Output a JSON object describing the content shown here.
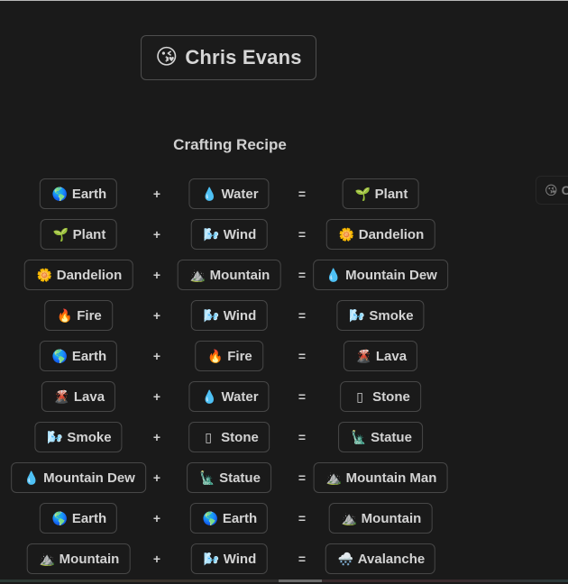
{
  "title_badge": {
    "emoji": "😘",
    "name": "Chris Evans"
  },
  "heading": "Crafting Recipe",
  "operators": {
    "plus": "+",
    "equals": "="
  },
  "recipes": [
    {
      "a": {
        "icon": "🌎",
        "label": "Earth"
      },
      "b": {
        "icon": "💧",
        "label": "Water"
      },
      "result": {
        "icon": "🌱",
        "label": "Plant"
      }
    },
    {
      "a": {
        "icon": "🌱",
        "label": "Plant"
      },
      "b": {
        "icon": "🌬️",
        "label": "Wind"
      },
      "result": {
        "icon": "🌼",
        "label": "Dandelion"
      }
    },
    {
      "a": {
        "icon": "🌼",
        "label": "Dandelion"
      },
      "b": {
        "icon": "⛰️",
        "label": "Mountain"
      },
      "result": {
        "icon": "💧",
        "label": "Mountain Dew"
      }
    },
    {
      "a": {
        "icon": "🔥",
        "label": "Fire"
      },
      "b": {
        "icon": "🌬️",
        "label": "Wind"
      },
      "result": {
        "icon": "🌬️",
        "label": "Smoke"
      }
    },
    {
      "a": {
        "icon": "🌎",
        "label": "Earth"
      },
      "b": {
        "icon": "🔥",
        "label": "Fire"
      },
      "result": {
        "icon": "🌋",
        "label": "Lava"
      }
    },
    {
      "a": {
        "icon": "🌋",
        "label": "Lava"
      },
      "b": {
        "icon": "💧",
        "label": "Water"
      },
      "result": {
        "icon": "▯",
        "label": "Stone"
      }
    },
    {
      "a": {
        "icon": "🌬️",
        "label": "Smoke"
      },
      "b": {
        "icon": "▯",
        "label": "Stone"
      },
      "result": {
        "icon": "🗽",
        "label": "Statue"
      }
    },
    {
      "a": {
        "icon": "💧",
        "label": "Mountain Dew"
      },
      "b": {
        "icon": "🗽",
        "label": "Statue"
      },
      "result": {
        "icon": "⛰️",
        "label": "Mountain Man"
      }
    },
    {
      "a": {
        "icon": "🌎",
        "label": "Earth"
      },
      "b": {
        "icon": "🌎",
        "label": "Earth"
      },
      "result": {
        "icon": "⛰️",
        "label": "Mountain"
      }
    },
    {
      "a": {
        "icon": "⛰️",
        "label": "Mountain"
      },
      "b": {
        "icon": "🌬️",
        "label": "Wind"
      },
      "result": {
        "icon": "🌨️",
        "label": "Avalanche"
      }
    }
  ],
  "side_badge": {
    "emoji": "😘",
    "name": "C"
  }
}
